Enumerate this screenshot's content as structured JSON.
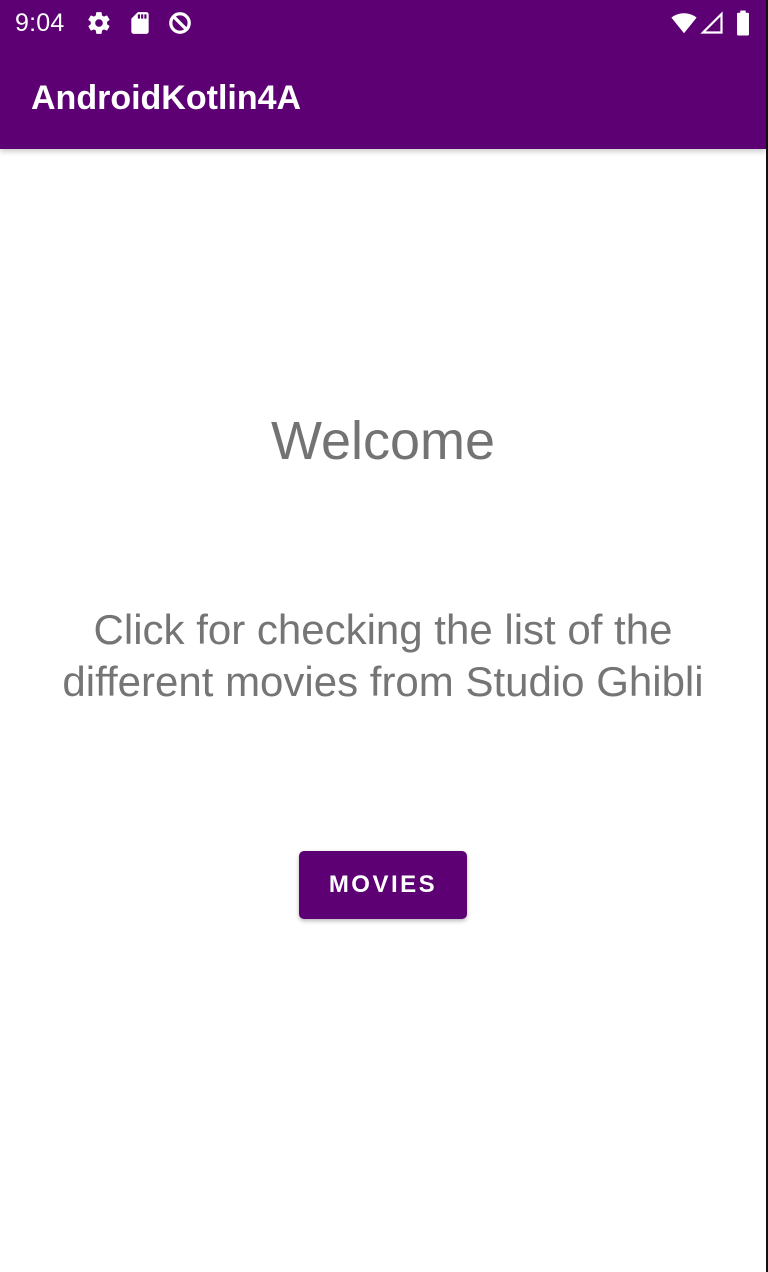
{
  "status_bar": {
    "time": "9:04",
    "left_icons": [
      "gear-icon",
      "sd-card-icon",
      "do-not-disturb-icon"
    ],
    "right_icons": [
      "wifi-icon",
      "cell-signal-icon",
      "battery-icon"
    ]
  },
  "app_bar": {
    "title": "AndroidKotlin4A"
  },
  "main": {
    "welcome": "Welcome",
    "description": "Click for checking the list of the different movies from Studio Ghibli",
    "button_label": "MOVIES"
  },
  "colors": {
    "primary": "#5c0073",
    "text_gray": "#757575",
    "background": "#ffffff"
  }
}
